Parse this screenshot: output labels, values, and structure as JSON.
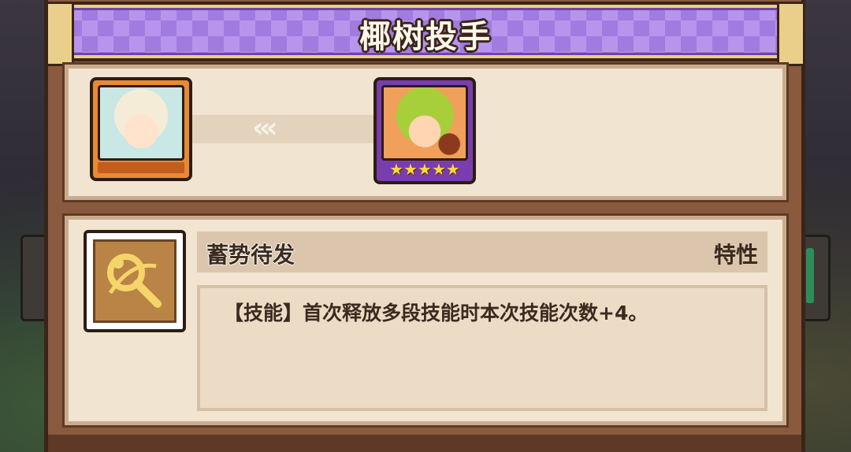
{
  "dialog": {
    "title": "椰树投手"
  },
  "evolution": {
    "from_unit": {
      "stars": ""
    },
    "arrow": "‹‹‹",
    "to_unit": {
      "stars": "★★★★★",
      "star_count": 5
    }
  },
  "skill": {
    "icon": "tennis-racket-icon",
    "name": "蓄势待发",
    "type": "特性",
    "description": "【技能】首次释放多段技能时本次技能次数+4。"
  },
  "colors": {
    "banner_purple": "#a27be0",
    "frame_brown": "#8a5a3e",
    "panel_cream": "#f1e4d0",
    "star_gold": "#ffd83a"
  }
}
